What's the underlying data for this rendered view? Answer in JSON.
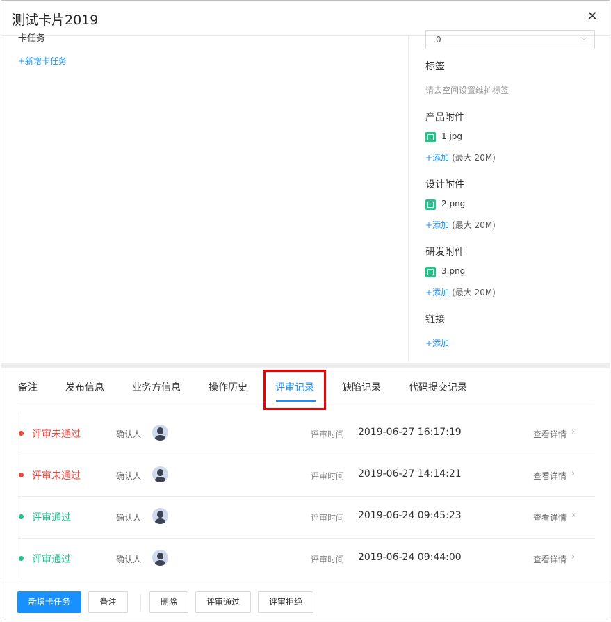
{
  "dialog": {
    "title": "测试卡片2019",
    "close_glyph": "✕"
  },
  "left": {
    "cut_label": "卡任务",
    "add_task": "+新增卡任务"
  },
  "right": {
    "select_value": "0",
    "tags_title": "标签",
    "tags_hint": "请去空间设置维护标签",
    "attachments": [
      {
        "title": "产品附件",
        "file": "1.jpg",
        "add": "+添加",
        "limit": "(最大 20M)"
      },
      {
        "title": "设计附件",
        "file": "2.png",
        "add": "+添加",
        "limit": "(最大 20M)"
      },
      {
        "title": "研发附件",
        "file": "3.png",
        "add": "+添加",
        "limit": "(最大 20M)"
      }
    ],
    "link_title": "链接",
    "link_add": "+添加"
  },
  "tabs": [
    "备注",
    "发布信息",
    "业务方信息",
    "操作历史",
    "评审记录",
    "缺陷记录",
    "代码提交记录"
  ],
  "active_tab": "评审记录",
  "records": [
    {
      "status": "评审未通过",
      "color": "#f0443b",
      "confirm": "确认人",
      "time_label": "评审时间",
      "time": "2019-06-27 16:17:19",
      "detail": "查看详情"
    },
    {
      "status": "评审未通过",
      "color": "#f0443b",
      "confirm": "确认人",
      "time_label": "评审时间",
      "time": "2019-06-27 14:14:21",
      "detail": "查看详情"
    },
    {
      "status": "评审通过",
      "color": "#1fbf8f",
      "confirm": "确认人",
      "time_label": "评审时间",
      "time": "2019-06-24 09:45:23",
      "detail": "查看详情"
    },
    {
      "status": "评审通过",
      "color": "#1fbf8f",
      "confirm": "确认人",
      "time_label": "评审时间",
      "time": "2019-06-24 09:44:00",
      "detail": "查看详情"
    }
  ],
  "footer": {
    "add_task": "新增卡任务",
    "note": "备注",
    "delete": "删除",
    "approve": "评审通过",
    "reject": "评审拒绝"
  },
  "colors": {
    "accent": "#1890ff",
    "fail": "#f0443b",
    "pass": "#1fbf8f",
    "highlight_box": "#e00000"
  }
}
